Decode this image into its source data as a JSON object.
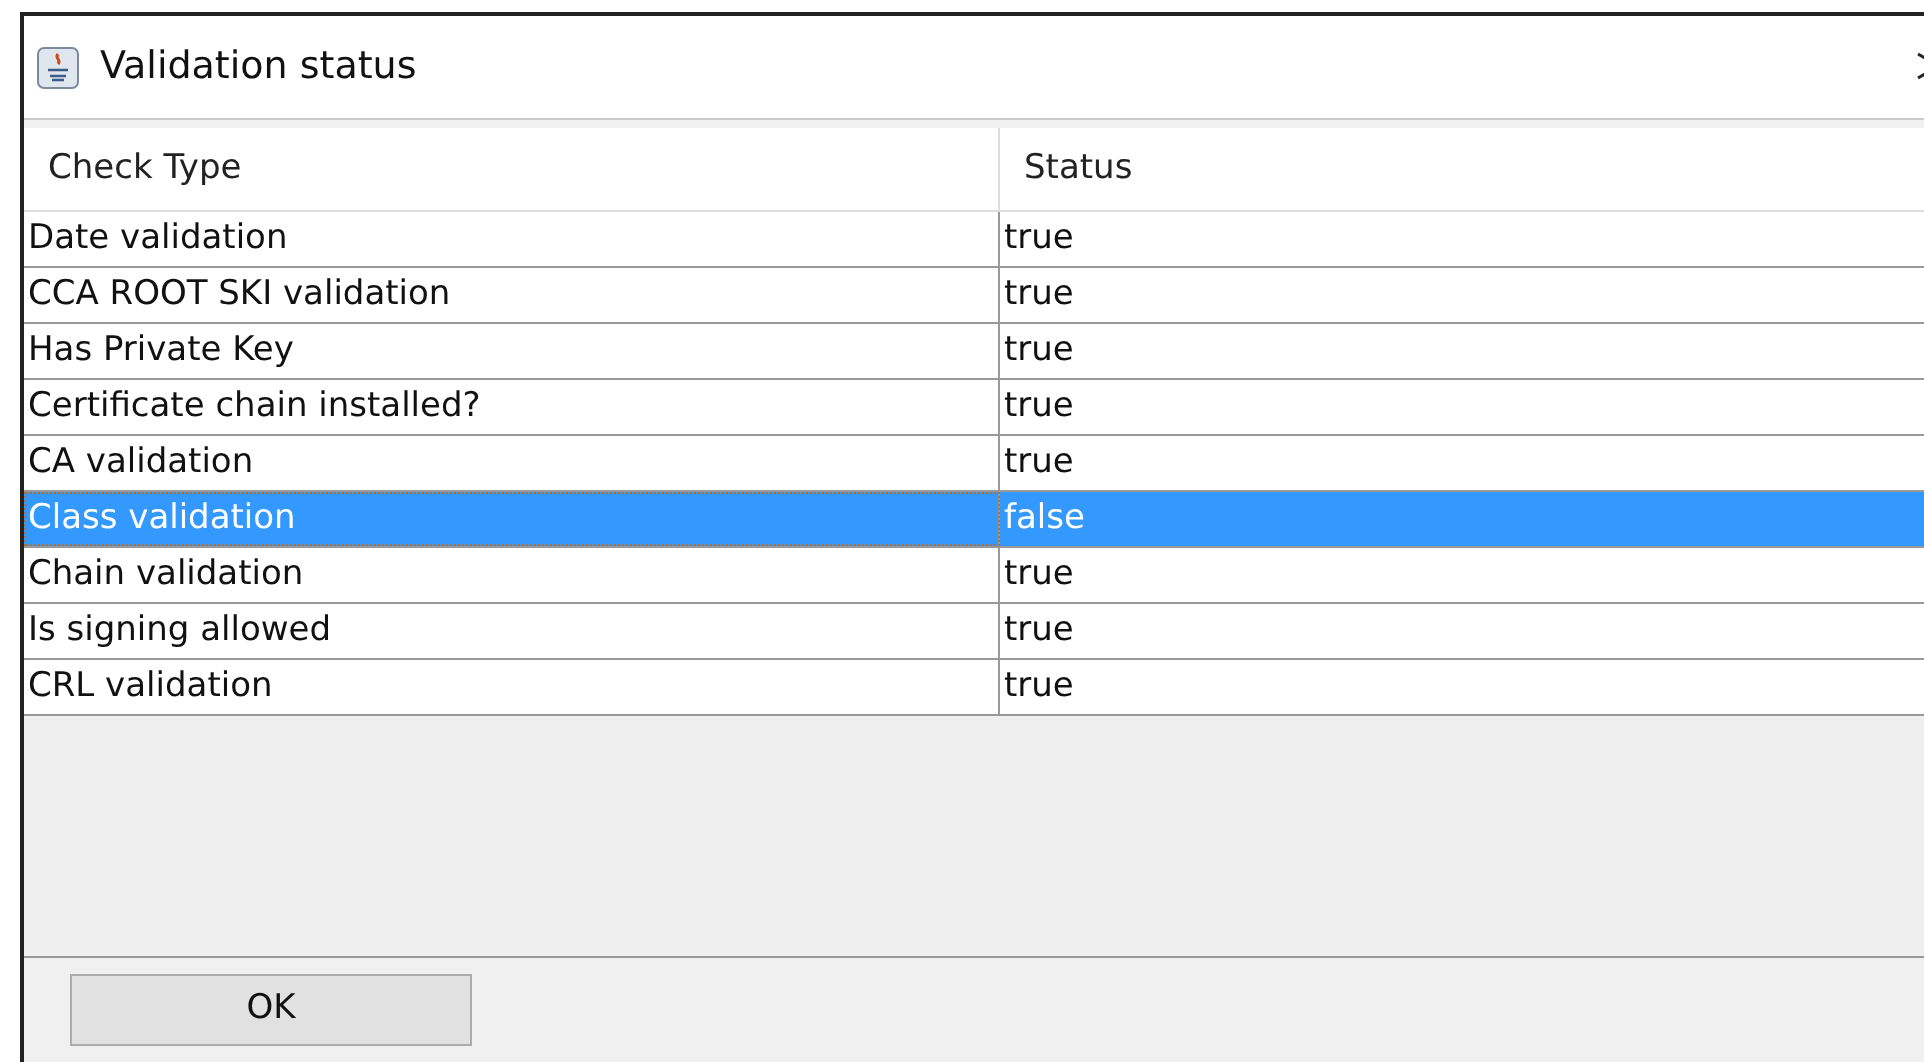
{
  "window": {
    "title": "Validation status"
  },
  "table": {
    "columns": [
      "Check Type",
      "Status"
    ],
    "rows": [
      {
        "check_type": "Date validation",
        "status": "true",
        "selected": false
      },
      {
        "check_type": "CCA ROOT SKI validation",
        "status": "true",
        "selected": false
      },
      {
        "check_type": "Has Private Key",
        "status": "true",
        "selected": false
      },
      {
        "check_type": "Certificate chain installed?",
        "status": "true",
        "selected": false
      },
      {
        "check_type": "CA validation",
        "status": "true",
        "selected": false
      },
      {
        "check_type": "Class validation",
        "status": "false",
        "selected": true
      },
      {
        "check_type": "Chain validation",
        "status": "true",
        "selected": false
      },
      {
        "check_type": "Is signing allowed",
        "status": "true",
        "selected": false
      },
      {
        "check_type": "CRL validation",
        "status": "true",
        "selected": false
      }
    ]
  },
  "buttons": [
    "OK"
  ]
}
